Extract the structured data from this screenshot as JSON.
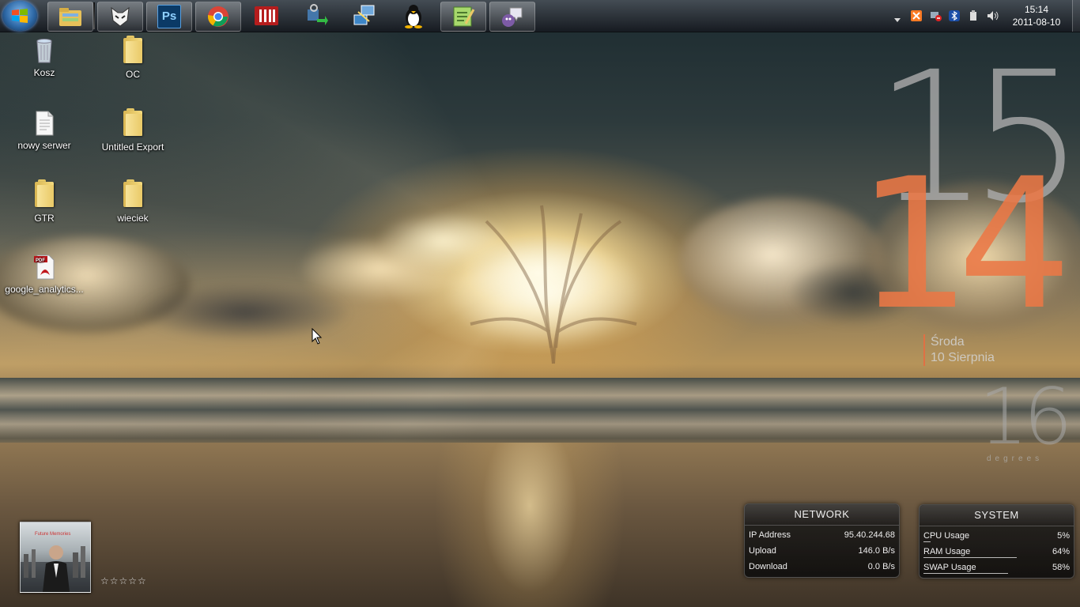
{
  "taskbar": {
    "pinned": [
      {
        "name": "explorer"
      },
      {
        "name": "foobar2000"
      },
      {
        "name": "photoshop",
        "label": "Ps"
      },
      {
        "name": "chrome"
      },
      {
        "name": "filezilla"
      },
      {
        "name": "network-app"
      },
      {
        "name": "remote-desktop"
      },
      {
        "name": "tux-app"
      },
      {
        "name": "notepad-plus-plus"
      },
      {
        "name": "pidgin"
      }
    ]
  },
  "clock": {
    "time": "15:14",
    "date": "2011-08-10"
  },
  "desktop": {
    "icons": [
      {
        "label": "Kosz"
      },
      {
        "label": "OC"
      },
      {
        "label": "nowy serwer"
      },
      {
        "label": "Untitled Export"
      },
      {
        "label": "GTR"
      },
      {
        "label": "wieciek"
      },
      {
        "label": "google_analytics..."
      }
    ]
  },
  "clock_widget": {
    "hour": "15",
    "minute": "14",
    "day": "Środa",
    "date": "10 Sierpnia",
    "temperature": "16",
    "temperature_label": "degrees"
  },
  "network_panel": {
    "title": "NETWORK",
    "rows": [
      {
        "label": "IP Address",
        "value": "95.40.244.68"
      },
      {
        "label": "Upload",
        "value": "146.0 B/s"
      },
      {
        "label": "Download",
        "value": "0.0 B/s"
      }
    ]
  },
  "system_panel": {
    "title": "SYSTEM",
    "rows": [
      {
        "label": "CPU Usage",
        "value": "5%",
        "level": 0.05
      },
      {
        "label": "RAM Usage",
        "value": "64%",
        "level": 0.64
      },
      {
        "label": "SWAP Usage",
        "value": "58%",
        "level": 0.58
      }
    ]
  },
  "media": {
    "album_text": "Future Memories",
    "rating_stars": "☆☆☆☆☆",
    "rating": 0
  },
  "colors": {
    "accent_orange": "#e07044",
    "clock_gray": "#aaaaaa"
  }
}
